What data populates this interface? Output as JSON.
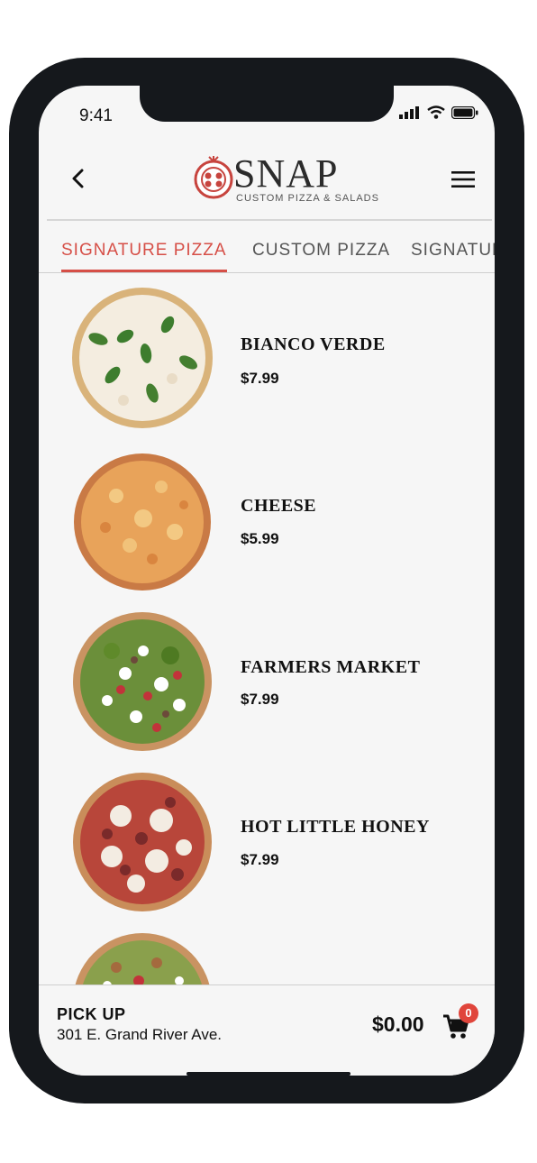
{
  "status_bar": {
    "time": "9:41"
  },
  "header": {
    "back_icon": "chevron-left-icon",
    "logo_text": "SNAP",
    "logo_subtitle": "CUSTOM PIZZA & SALADS",
    "menu_icon": "hamburger-menu-icon"
  },
  "tabs": [
    {
      "label": "SIGNATURE PIZZA",
      "active": true
    },
    {
      "label": "CUSTOM PIZZA",
      "active": false
    },
    {
      "label": "SIGNATURE",
      "active": false
    }
  ],
  "menu_items": [
    {
      "name": "BIANCO VERDE",
      "price": "$7.99"
    },
    {
      "name": "CHEESE",
      "price": "$5.99"
    },
    {
      "name": "FARMERS MARKET",
      "price": "$7.99"
    },
    {
      "name": "HOT LITTLE HONEY",
      "price": "$7.99"
    }
  ],
  "footer": {
    "pickup_title": "PICK UP",
    "pickup_address": "301 E. Grand River Ave.",
    "total": "$0.00",
    "cart_count": "0",
    "cart_icon": "shopping-cart-icon"
  },
  "colors": {
    "accent": "#d64f47",
    "badge": "#e0453b",
    "frame": "#15181c"
  }
}
